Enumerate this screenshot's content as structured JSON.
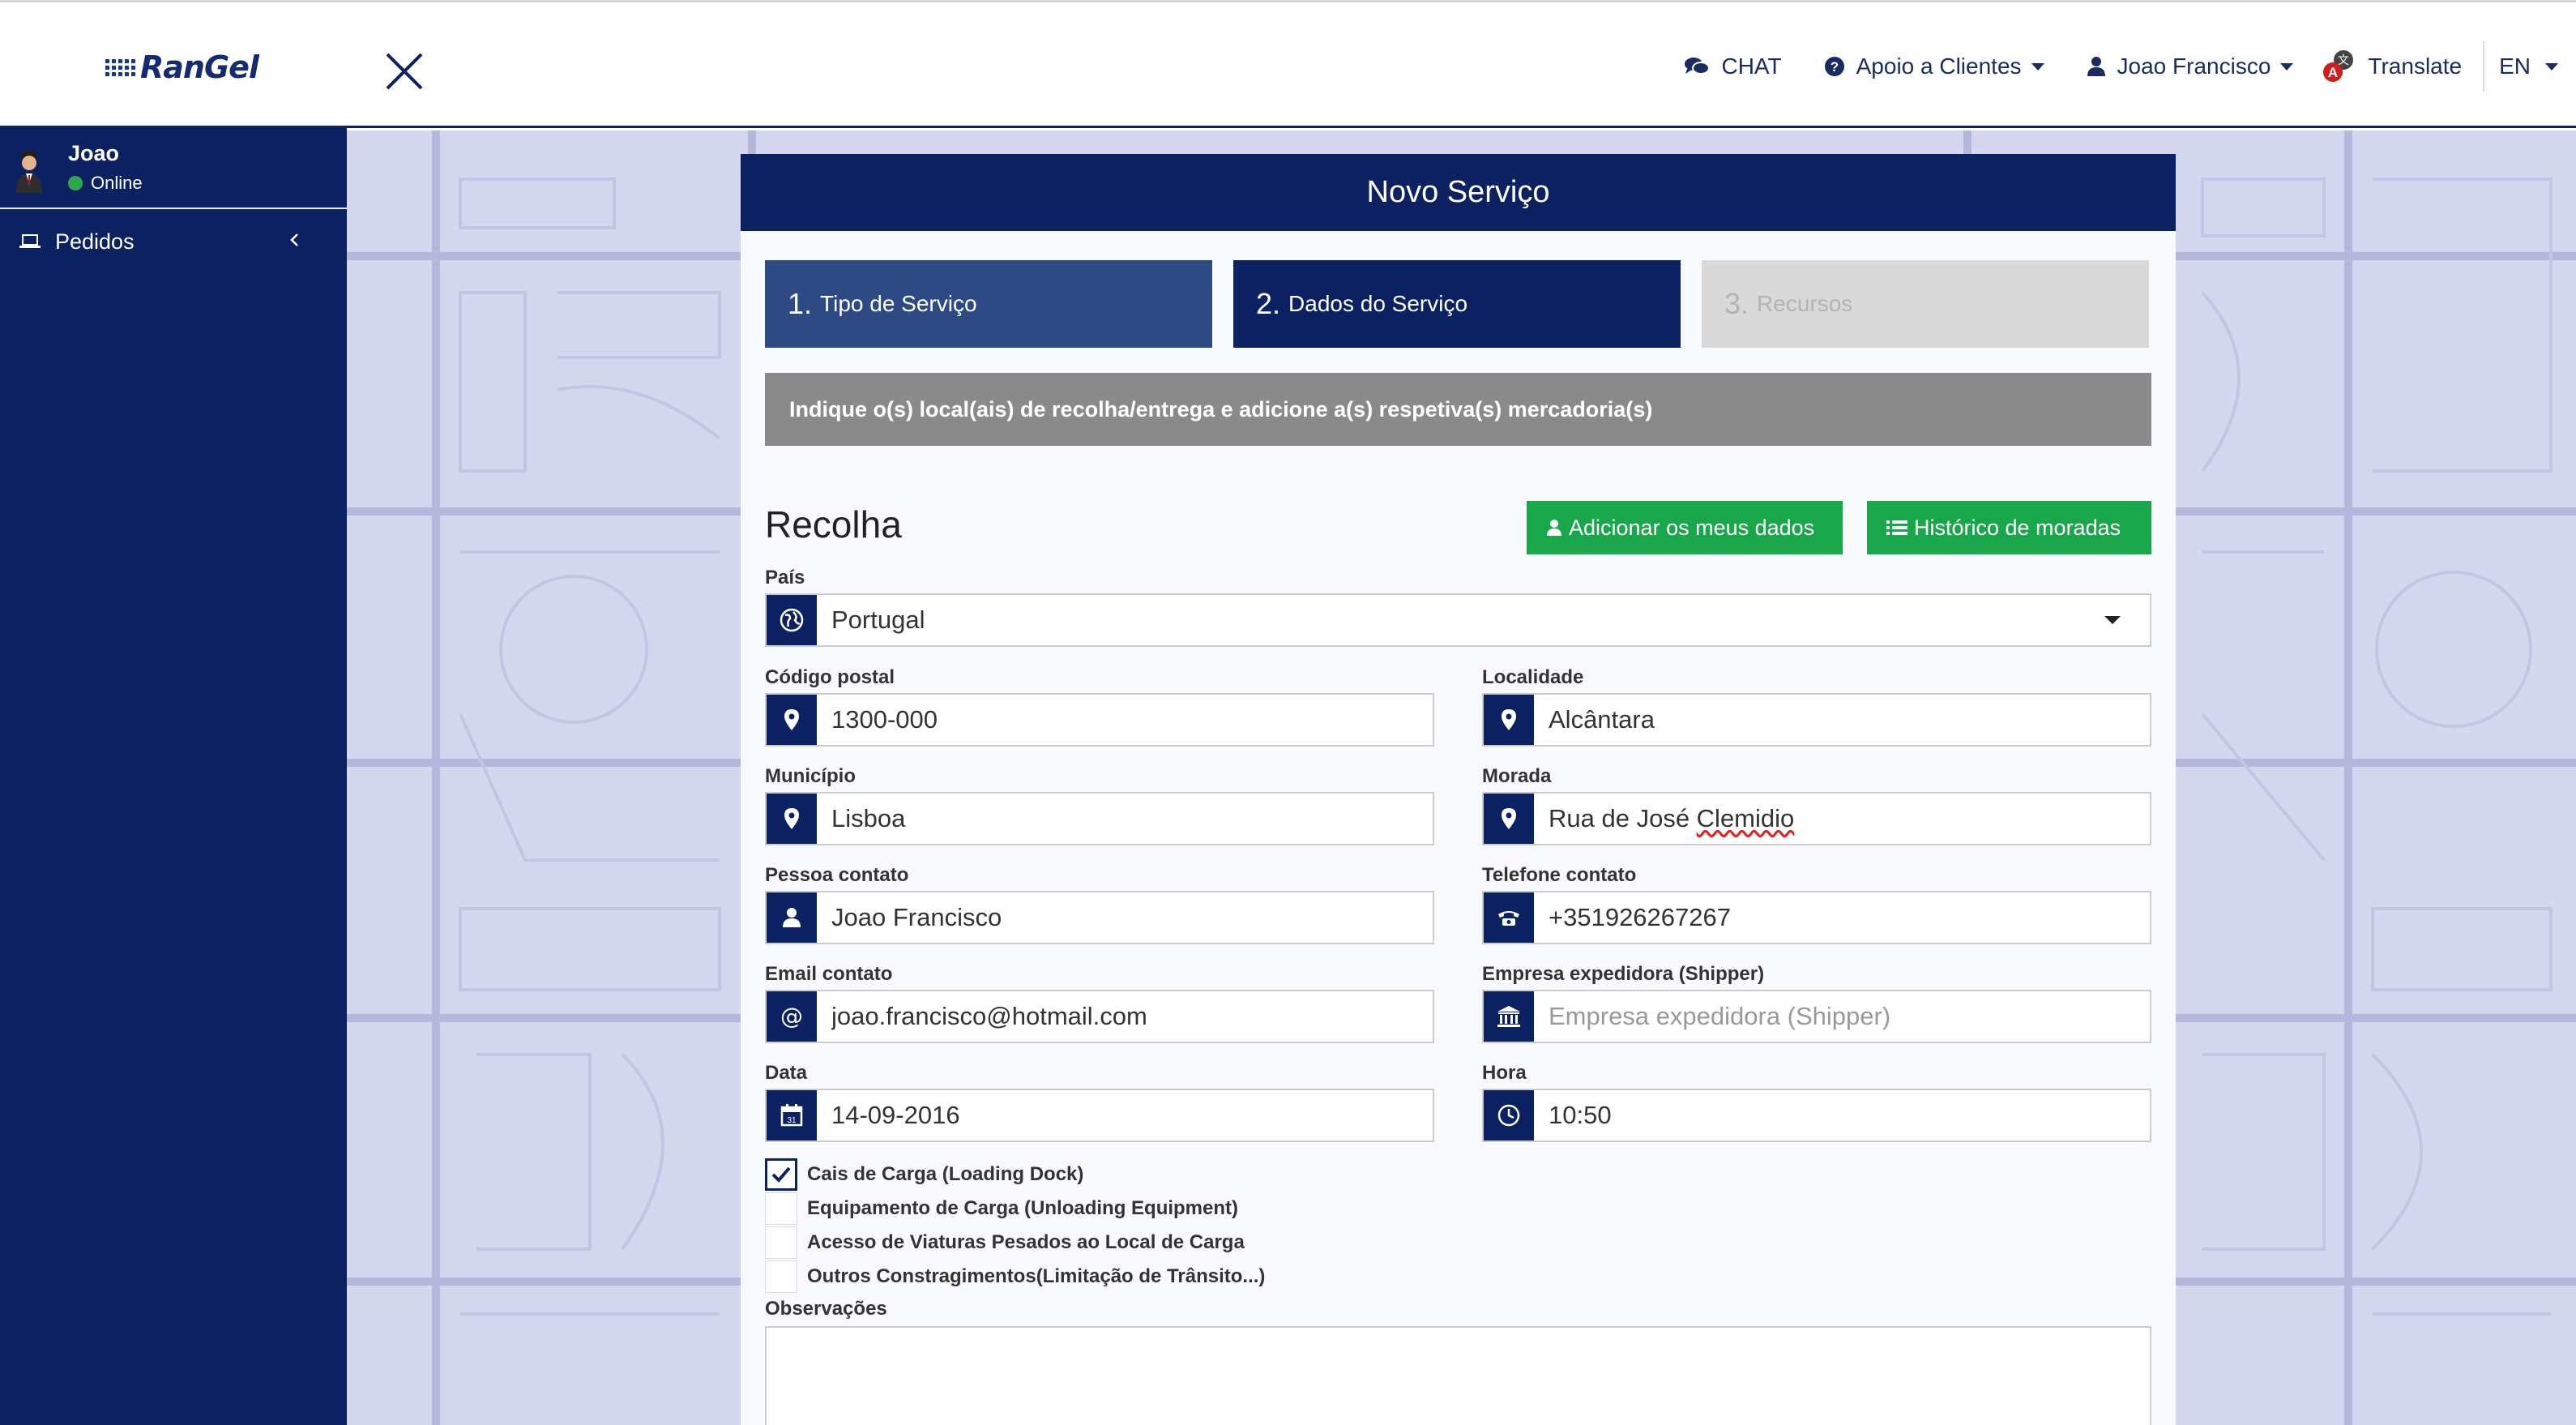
{
  "topbar": {
    "logo_text": "RanGel",
    "nav": {
      "chat": "CHAT",
      "support": "Apoio a Clientes",
      "user": "Joao Francisco",
      "translate": "Translate",
      "language": "EN"
    }
  },
  "sidebar": {
    "user_name": "Joao",
    "status": "Online",
    "menu": [
      {
        "label": "Pedidos"
      }
    ]
  },
  "card": {
    "title": "Novo Serviço",
    "steps": [
      {
        "num": "1.",
        "label": "Tipo de Serviço"
      },
      {
        "num": "2.",
        "label": "Dados do Serviço"
      },
      {
        "num": "3.",
        "label": "Recursos"
      }
    ],
    "info": "Indique o(s) local(ais) de recolha/entrega e adicione a(s) respetiva(s) mercadoria(s)",
    "section_title": "Recolha",
    "buttons": {
      "add_my_data": "Adicionar os meus dados",
      "history": "Histórico de moradas"
    },
    "fields": {
      "pais": {
        "label": "País",
        "value": "Portugal"
      },
      "codigo_postal": {
        "label": "Código postal",
        "value": "1300-000"
      },
      "localidade": {
        "label": "Localidade",
        "value": "Alcântara"
      },
      "municipio": {
        "label": "Município",
        "value": "Lisboa"
      },
      "morada": {
        "label": "Morada",
        "value_prefix": "Rua de José ",
        "value_misspelled": "Clemidio"
      },
      "pessoa_contato": {
        "label": "Pessoa contato",
        "value": "Joao Francisco"
      },
      "telefone_contato": {
        "label": "Telefone contato",
        "value": "+351926267267"
      },
      "email_contato": {
        "label": "Email contato",
        "value": "joao.francisco@hotmail.com"
      },
      "empresa_expedidora": {
        "label": "Empresa expedidora (Shipper)",
        "placeholder": "Empresa expedidora (Shipper)"
      },
      "data": {
        "label": "Data",
        "value": "14-09-2016",
        "icon_day": "31"
      },
      "hora": {
        "label": "Hora",
        "value": "10:50"
      }
    },
    "checkboxes": [
      {
        "label": "Cais de Carga (Loading Dock)",
        "checked": true
      },
      {
        "label": "Equipamento de Carga (Unloading Equipment)",
        "checked": false
      },
      {
        "label": "Acesso de Viaturas Pesados ao Local de Carga",
        "checked": false
      },
      {
        "label": "Outros Constragimentos(Limitação de Trânsito...)",
        "checked": false
      }
    ],
    "observacoes_label": "Observações"
  },
  "colors": {
    "navy": "#0c2161",
    "green": "#1aa64b",
    "gray_bar": "#8a8a8a",
    "map_bg": "#d5d7ee"
  }
}
